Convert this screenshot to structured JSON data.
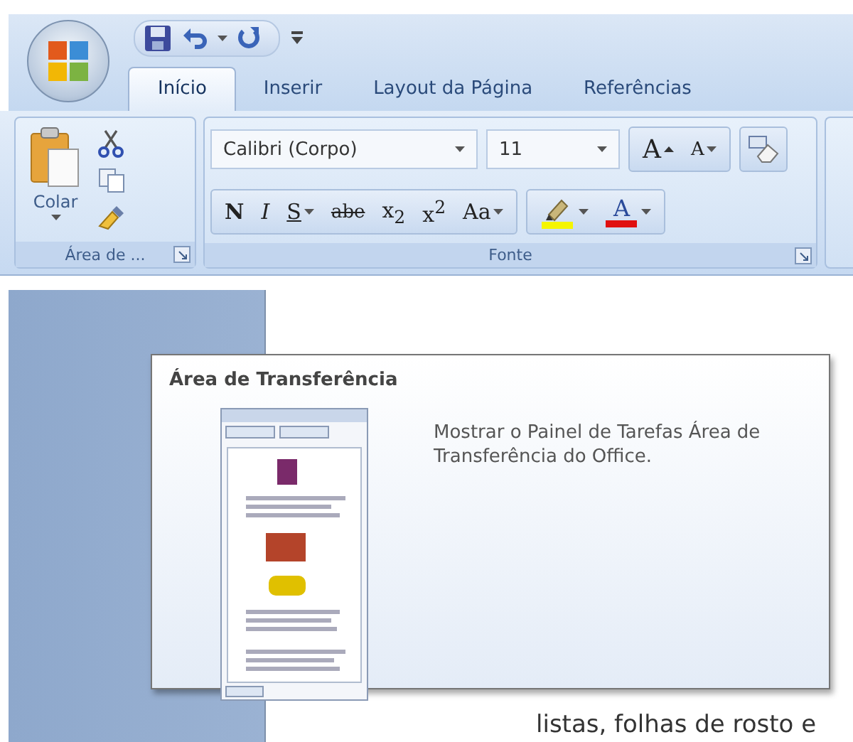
{
  "tabs": [
    {
      "label": "Início",
      "selected": true
    },
    {
      "label": "Inserir",
      "selected": false
    },
    {
      "label": "Layout da Página",
      "selected": false
    },
    {
      "label": "Referências",
      "selected": false
    }
  ],
  "clipboard_group": {
    "label": "Área de ...",
    "paste_label": "Colar"
  },
  "font_group": {
    "label": "Fonte",
    "font_name": "Calibri (Corpo)",
    "font_size": "11",
    "grow_label": "A",
    "shrink_label": "A",
    "format_buttons": [
      {
        "label": "N",
        "kind": "bold",
        "dropdown": false
      },
      {
        "label": "I",
        "kind": "italic",
        "dropdown": false
      },
      {
        "label": "S",
        "kind": "underline",
        "dropdown": true
      },
      {
        "label": "abe",
        "kind": "strike",
        "dropdown": false
      },
      {
        "label": "x$_{2}$",
        "kind": "plain",
        "dropdown": false
      },
      {
        "label": "x$^{2}$",
        "kind": "plain",
        "dropdown": false
      },
      {
        "label": "Aa",
        "kind": "plain",
        "dropdown": true
      }
    ],
    "color_buttons": [
      {
        "kind": "highlight",
        "color": "#f5f500"
      },
      {
        "kind": "font-color",
        "label": "A",
        "color": "#e01010"
      }
    ]
  },
  "tooltip": {
    "title": "Área de Transferência",
    "description": "Mostrar o Painel de Tarefas Área de Transferência do Office."
  },
  "document": {
    "text": "listas, folhas de rosto e"
  }
}
